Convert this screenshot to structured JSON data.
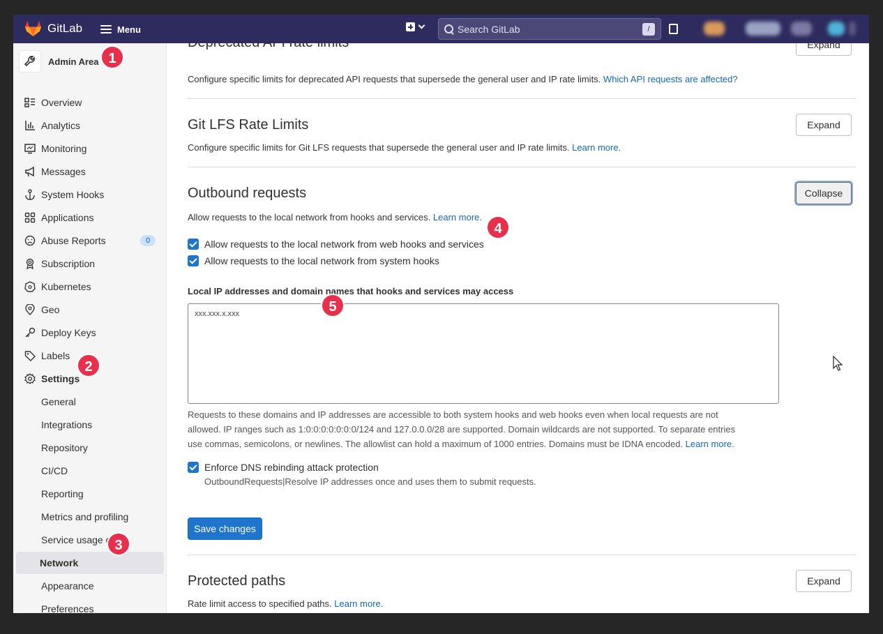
{
  "navbar": {
    "brand": "GitLab",
    "menu_label": "Menu",
    "search_placeholder": "Search GitLab",
    "search_shortcut": "/"
  },
  "sidebar": {
    "title": "Admin Area",
    "items": [
      {
        "label": "Overview"
      },
      {
        "label": "Analytics"
      },
      {
        "label": "Monitoring"
      },
      {
        "label": "Messages"
      },
      {
        "label": "System Hooks"
      },
      {
        "label": "Applications"
      },
      {
        "label": "Abuse Reports",
        "badge": "0"
      },
      {
        "label": "Subscription"
      },
      {
        "label": "Kubernetes"
      },
      {
        "label": "Geo"
      },
      {
        "label": "Deploy Keys"
      },
      {
        "label": "Labels"
      },
      {
        "label": "Settings"
      }
    ],
    "settings_items": [
      {
        "label": "General"
      },
      {
        "label": "Integrations"
      },
      {
        "label": "Repository"
      },
      {
        "label": "CI/CD"
      },
      {
        "label": "Reporting"
      },
      {
        "label": "Metrics and profiling"
      },
      {
        "label": "Service usage data"
      },
      {
        "label": "Network"
      },
      {
        "label": "Appearance"
      },
      {
        "label": "Preferences"
      }
    ]
  },
  "markers": [
    "1",
    "2",
    "3",
    "4",
    "5"
  ],
  "sections": {
    "deprecated": {
      "title": "Deprecated API rate limits",
      "button": "Expand",
      "desc": "Configure specific limits for deprecated API requests that supersede the general user and IP rate limits.",
      "link": "Which API requests are affected?"
    },
    "lfs": {
      "title": "Git LFS Rate Limits",
      "button": "Expand",
      "desc": "Configure specific limits for Git LFS requests that supersede the general user and IP rate limits.",
      "link": "Learn more."
    },
    "outbound": {
      "title": "Outbound requests",
      "button": "Collapse",
      "desc": "Allow requests to the local network from hooks and services.",
      "link": "Learn more.",
      "cb_webhooks": "Allow requests to the local network from web hooks and services",
      "cb_system": "Allow requests to the local network from system hooks",
      "allowlist_label": "Local IP addresses and domain names that hooks and services may access",
      "allowlist_value": "xxx.xxx.x.xxx",
      "help_line1": "Requests to these domains and IP addresses are accessible to both system hooks and web hooks even when local requests are not",
      "help_line2": "allowed. IP ranges such as 1:0:0:0:0:0:0:0/124 and 127.0.0.0/28 are supported. Domain wildcards are not supported. To separate entries",
      "help_line3": "use commas, semicolons, or newlines. The allowlist can hold a maximum of 1000 entries. Domains must be IDNA encoded.",
      "help_link": "Learn more.",
      "cb_dns": "Enforce DNS rebinding attack protection",
      "dns_help": "OutboundRequests|Resolve IP addresses once and uses them to submit requests.",
      "save": "Save changes"
    },
    "protected": {
      "title": "Protected paths",
      "button": "Expand",
      "desc": "Rate limit access to specified paths.",
      "link": "Learn more."
    }
  },
  "colors": {
    "navbar": "#2e2b5e",
    "primary": "#1f75cb",
    "link": "#1068bf",
    "marker": "#e8304d"
  }
}
